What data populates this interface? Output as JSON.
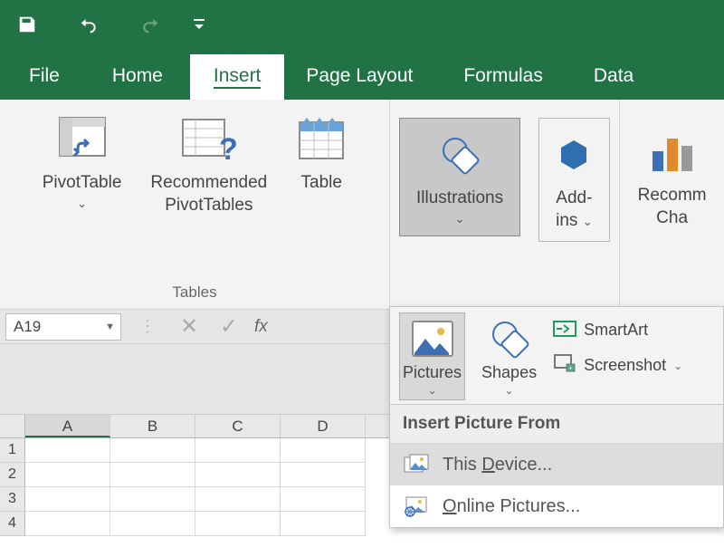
{
  "qat": {
    "save": "save",
    "undo": "undo",
    "redo": "redo"
  },
  "tabs": {
    "file": "File",
    "home": "Home",
    "insert": "Insert",
    "page_layout": "Page Layout",
    "formulas": "Formulas",
    "data": "Data"
  },
  "ribbon": {
    "tables_group": "Tables",
    "pivottable": "PivotTable",
    "recommended_pivottables_l1": "Recommended",
    "recommended_pivottables_l2": "PivotTables",
    "table": "Table",
    "illustrations": "Illustrations",
    "addins_l1": "Add-",
    "addins_l2": "ins",
    "recommended_charts_l1": "Recomm",
    "recommended_charts_l2": "Cha"
  },
  "namebox": "A19",
  "fx": "fx",
  "illus_panel": {
    "pictures": "Pictures",
    "shapes": "Shapes",
    "smartart": "SmartArt",
    "screenshot": "Screenshot",
    "submenu_header": "Insert Picture From",
    "this_device": "This Device...",
    "online_pictures": "Online Pictures..."
  },
  "columns": [
    "A",
    "B",
    "C",
    "D"
  ],
  "rows": [
    "1",
    "2",
    "3",
    "4"
  ]
}
